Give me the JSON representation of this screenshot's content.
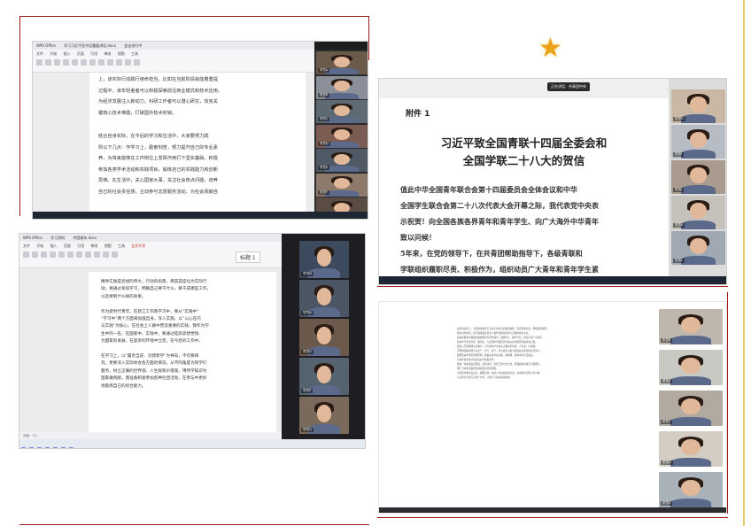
{
  "accent_colors": {
    "frame_red": "#9b1b1b",
    "frame_gold": "#e8c86a",
    "star": "#e9a21a"
  },
  "decorations": {
    "star_icon": "★"
  },
  "shot1": {
    "tabs": [
      "WPS Office",
      "学习习近平总书记重要讲话.docx",
      "会议进行中"
    ],
    "ribbon_tabs": [
      "文件",
      "开始",
      "插入",
      "页面",
      "引用",
      "审阅",
      "视图",
      "工具"
    ],
    "paragraph_1": "上，该实际行动践行使命担当。比如在当前阶段就能着重提\n过程中，该年轻者者可以积极探索前沿商业模式和技术应用，\n为经济发展注入新动力。科研工作者可以潜心研究，攻克关\n键核心技术难题，打破国外技术封锁。",
    "paragraph_2": "结合自身实际，在今后的学习和生活中，大家要努力践\n则以下几点：作学习上，勤奋刻苦，努力提升自己的专业素\n养，为将来能够在工作岗位上发挥作用打下坚实基础。积极\n参加各类学术活动和实践项目，锻炼自己的实践能力和创新\n思维。在生活中，关心国家大事，关注社会热点问题，培养\n自己的社会责任感，主动参与志愿服务活动，为社会贡献自"
  },
  "shot2": {
    "window_title": "正在讲话：共青团中央",
    "heading_label": "附件 1",
    "title_line_1": "习近平致全国青联十四届全委会和",
    "title_line_2": "全国学联二十八大的贺信",
    "body_1": "值此中华全国青年联合会第十四届委员会全体会议和中华\n全国学生联合会第二十八次代表大会开幕之际，我代表党中央表\n示祝贺！向全国各族各界青年和青年学生、向广大海外中华青年\n致以问候！",
    "body_2": "5年来，在党的领导下，在共青团帮助指导下，各级青联和\n学联组织履职尽责、积极作为，组织动员广大青年和青年学生紧"
  },
  "shot3": {
    "tabs": [
      "WPS Office",
      "学习资料",
      "中国青年.docx"
    ],
    "ribbon_tabs": [
      "文件",
      "开始",
      "插入",
      "页面",
      "引用",
      "审阅",
      "视图",
      "工具",
      "会员专享"
    ],
    "style_label": "标题 1",
    "body": "精神实质是思想的伟大，行动的指南，用其其提化为实际行\n动。要通过系统学习，明确自己要干什么，要干成哪些工作，\n以及要到什么样的效果。\n\n作为新时代青年，在新江工作政学习中，要从“实践中”\n“学习中”两个方面来加强自身，深入实施。以“公心在内\n与实践”为核心，在社会上人群中营造重要的实践，我作为学\n生中的一名，在国家中、实践中，要通过提高思想觉悟、\n为国家的发展，在复杂的环境中立足。在今后的工作中。\n\n在学习上，以“履责当前、对建新学”为导向，不仅要研\n究，更要深入实际体会各方面的情况，从不同角度为同学们\n服务，树立正确的世界观、人生观和价值观，用所学知识为\n国家做贡献，我准备积极参加各种社团活动，在参与中更好\n地锻炼自己的综合能力。",
    "status_text": "页面：1/1"
  },
  "shot4": {
    "doc_body": "在新的征程上，全国青年要牢记习近平总书记的殷切嘱托，坚定理想信念，厚植爱国情怀，\n勇担时代使命，在全面建设社会主义现代化国家的伟大实践中建功立业。\n各级青联和学联组织要始终坚持党的领导，围绕中心、服务大局，团结引领广大青年\n和青年学生听党话、跟党走，为实现中华民族伟大复兴的中国梦贡献青春力量。\n要深入开展理想信念教育，引导青年学生树立正确的世界观、人生观、价值观，\n不断增强做中国人的志气、骨气、底气，努力成长为堪当民族复兴重任的时代新人。\n要聚焦青年所思所想所盼，积极为青年办实事、解难题，维护青年合法权益，\n为青年成长成才创造良好环境和条件。\n要进一步加强自身建设，深化改革，创新工作方式方法，增强组织的吸引力凝聚力，\n把广大青年更加紧密地团结在党的周围。\n全国青年要志存高远、脚踏实地，在奋斗中绽放青春光彩，在奉献中实现人生价值，\n以实际行动书写无愧于时代、无愧于人民的青春篇章。"
  },
  "participants": {
    "shot1": [
      "学员A",
      "学员B",
      "学员C",
      "学员D",
      "学员E",
      "学员F",
      "学员G"
    ],
    "shot2": [
      "学员H",
      "学员I",
      "学员J",
      "学员K",
      "学员L"
    ],
    "shot3": [
      "学员M",
      "学员N",
      "学员O",
      "学员P",
      "学员Q"
    ],
    "shot4": [
      "学员R",
      "学员S",
      "学员T",
      "学员U",
      "学员V"
    ]
  }
}
